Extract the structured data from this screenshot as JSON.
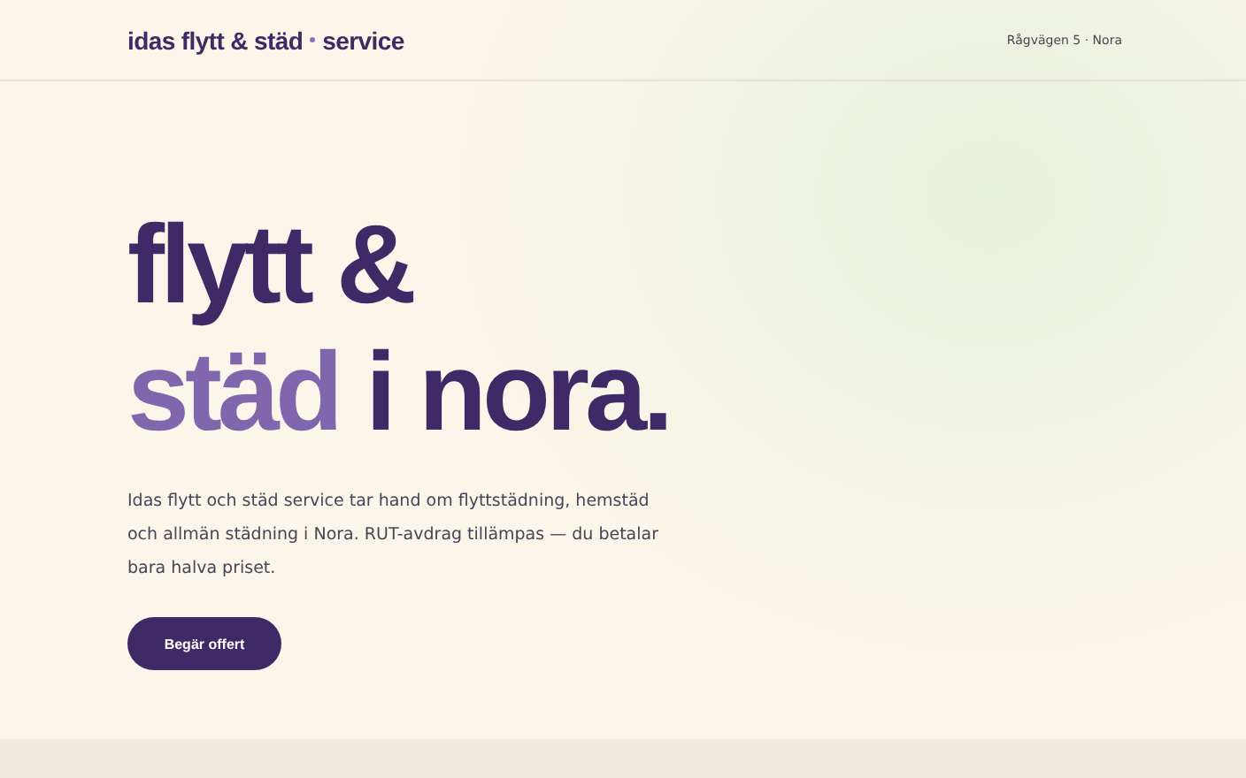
{
  "header": {
    "brand": {
      "name": "idas flytt & städ",
      "suffix": "service"
    },
    "address": "Rågvägen 5 · Nora"
  },
  "hero": {
    "heading": [
      [
        {
          "text": "flytt &",
          "accent": false
        }
      ],
      [
        {
          "text": "städ",
          "accent": true
        },
        {
          "text": " i nora.",
          "accent": false
        }
      ]
    ],
    "description": "Idas flytt och städ service tar hand om flyttstädning, hemstäd och allmän städning i Nora. RUT-avdrag tillämpas — du betalar bara halva priset.",
    "cta": "Begär offert"
  }
}
